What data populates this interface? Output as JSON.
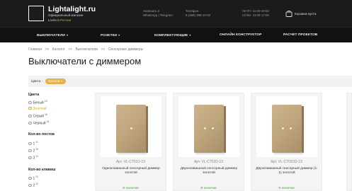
{
  "header": {
    "logo_title": "Lightalight.ru",
    "logo_sub": "Официальный магазин",
    "logo_sub2_prefix": "Livolo в",
    "logo_sub2_highlight": "России",
    "contact_line1": "Написать в",
    "contact_line2": "WhatsApp | Telegram",
    "phone_label": "Телефон",
    "phone_number": "8 (499) 398-10-62",
    "hours_line1": "Пн-Пт: 11:00-18:00",
    "hours_line2": "Сб-Вс: 11:00-17:00",
    "cart_label": "Корзина пуста"
  },
  "nav": [
    {
      "label": "ВЫКЛЮЧАТЕЛИ",
      "has_dropdown": true
    },
    {
      "label": "РОЗЕТКИ",
      "has_dropdown": true
    },
    {
      "label": "КОМПЛЕКТУЮЩИЕ",
      "has_dropdown": true
    },
    {
      "label": "ОНЛАЙН КОНСТРУКТОР",
      "has_dropdown": false
    },
    {
      "label": "РАСЧЕТ ПРОЕКТОВ",
      "has_dropdown": false
    }
  ],
  "breadcrumb": [
    "Главная",
    ">>",
    "Каталог",
    ">>",
    "Выключатели",
    ">>",
    "Сенсорные диммеры"
  ],
  "page_title": "Выключатели с диммером",
  "filter": {
    "label": "Цвета :",
    "chip": "Золотой ✕"
  },
  "sidebar": {
    "colors_title": "Цвета",
    "colors": [
      {
        "label": "Белый",
        "count": "16"
      },
      {
        "label": "Золотой",
        "count": "",
        "active": true
      },
      {
        "label": "Серый",
        "count": "16"
      },
      {
        "label": "Черный",
        "count": "16"
      }
    ],
    "posts_title": "Кол-во постов",
    "posts": [
      {
        "label": "1",
        "count": "11"
      },
      {
        "label": "2",
        "count": "26"
      },
      {
        "label": "3",
        "count": "10"
      }
    ],
    "keys_title": "Кол-во клавиш",
    "keys": [
      {
        "label": "1",
        "count": "20"
      },
      {
        "label": "2",
        "count": "10"
      }
    ]
  },
  "products": [
    {
      "art": "Арт. VL-C701D-13",
      "name": "Одноклавишный сенсорный диммер золотой",
      "stock": "В наличии"
    },
    {
      "art": "Арт. VL-C702D-13",
      "name": "Двухклавишный сенсорный диммер золотой",
      "stock": "В наличии"
    },
    {
      "art": "Арт. VL-C702DD-13",
      "name": "Двухклавишный сенсорный диммер (1-1) золотой",
      "stock": "В наличии"
    }
  ],
  "colors": {
    "header_bg": "#1b1b1b",
    "nav_bg": "#111111",
    "accent": "#d4a83a",
    "in_stock": "#4aa84a"
  }
}
